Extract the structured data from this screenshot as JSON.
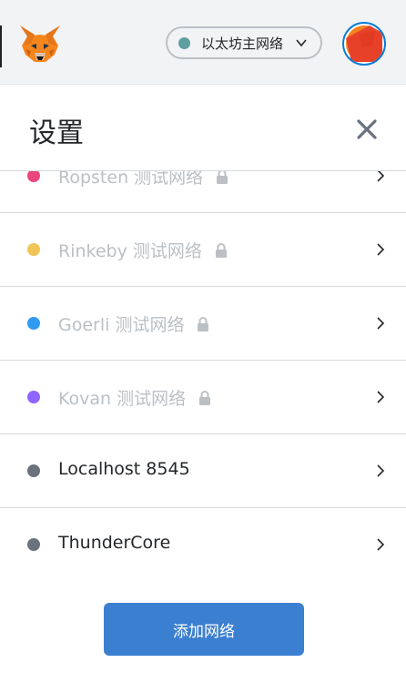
{
  "header": {
    "logo_icon": "metamask-fox-icon",
    "network_selector": {
      "label": "以太坊主网络",
      "dot_color": "#5f9ea0",
      "icon": "chevron-down-icon"
    },
    "avatar_icon": "account-avatar-icon"
  },
  "settings": {
    "title": "设置",
    "close_icon": "close-icon"
  },
  "networks": [
    {
      "label": "Ropsten 测试网络",
      "color": "#e8467c",
      "locked": true
    },
    {
      "label": "Rinkeby 测试网络",
      "color": "#f0c555",
      "locked": true
    },
    {
      "label": "Goerli 测试网络",
      "color": "#3099f2",
      "locked": true
    },
    {
      "label": "Kovan 测试网络",
      "color": "#9064ff",
      "locked": true
    },
    {
      "label": "Localhost 8545",
      "color": "#6a737d",
      "locked": false
    },
    {
      "label": "ThunderCore",
      "color": "#6a737d",
      "locked": false
    }
  ],
  "footer": {
    "add_network_label": "添加网络"
  }
}
